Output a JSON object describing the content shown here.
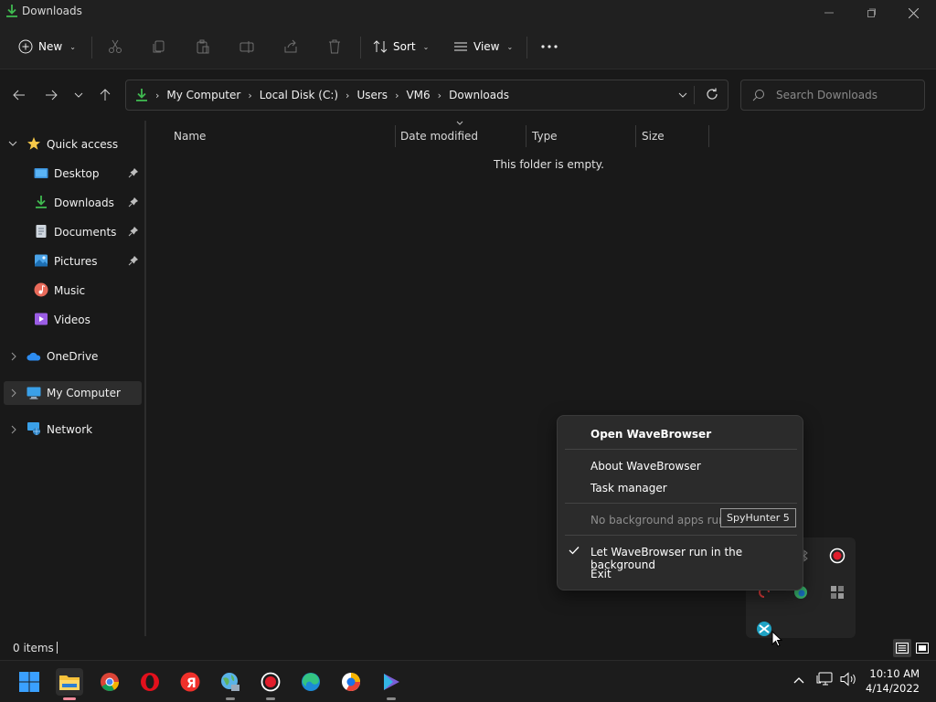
{
  "window": {
    "title": "Downloads",
    "minimize_icon": "minimize-icon",
    "maximize_icon": "maximize-icon",
    "close_icon": "close-icon"
  },
  "command_bar": {
    "new_label": "New",
    "sort_label": "Sort",
    "view_label": "View",
    "disabled_actions": [
      "cut-icon",
      "copy-icon",
      "paste-icon",
      "rename-icon",
      "share-icon",
      "delete-icon"
    ]
  },
  "address_bar": {
    "breadcrumbs": [
      "My Computer",
      "Local Disk (C:)",
      "Users",
      "VM6",
      "Downloads"
    ]
  },
  "search": {
    "placeholder": "Search Downloads"
  },
  "nav_pane": {
    "quick_access": "Quick access",
    "items": [
      {
        "label": "Desktop",
        "icon": "desktop-folder-icon",
        "pinned": true
      },
      {
        "label": "Downloads",
        "icon": "downloads-folder-icon",
        "pinned": true
      },
      {
        "label": "Documents",
        "icon": "documents-folder-icon",
        "pinned": true
      },
      {
        "label": "Pictures",
        "icon": "pictures-folder-icon",
        "pinned": true
      },
      {
        "label": "Music",
        "icon": "music-folder-icon",
        "pinned": false
      },
      {
        "label": "Videos",
        "icon": "videos-folder-icon",
        "pinned": false
      }
    ],
    "onedrive": "OneDrive",
    "my_computer": "My Computer",
    "network": "Network"
  },
  "content": {
    "columns": [
      "Name",
      "Date modified",
      "Type",
      "Size"
    ],
    "empty_message": "This folder is empty."
  },
  "status_bar": {
    "item_count": "0 items"
  },
  "context_menu": {
    "open": "Open WaveBrowser",
    "about": "About WaveBrowser",
    "task_manager": "Task manager",
    "no_bg_apps": "No background apps runni",
    "let_run": "Let WaveBrowser run in the background",
    "exit": "Exit",
    "tooltip": "SpyHunter 5"
  },
  "taskbar": {
    "apps": [
      "start-icon",
      "file-explorer-icon",
      "chrome-icon",
      "opera-icon",
      "yandex-icon",
      "network-globe-icon",
      "record-icon",
      "edge-icon",
      "wavebrowser-icon",
      "play-icon"
    ],
    "time": "10:10 AM",
    "date": "4/14/2022"
  },
  "colors": {
    "accent_green": "#3fb950",
    "yandex_red": "#f0302a",
    "opera_red": "#e3101c"
  }
}
